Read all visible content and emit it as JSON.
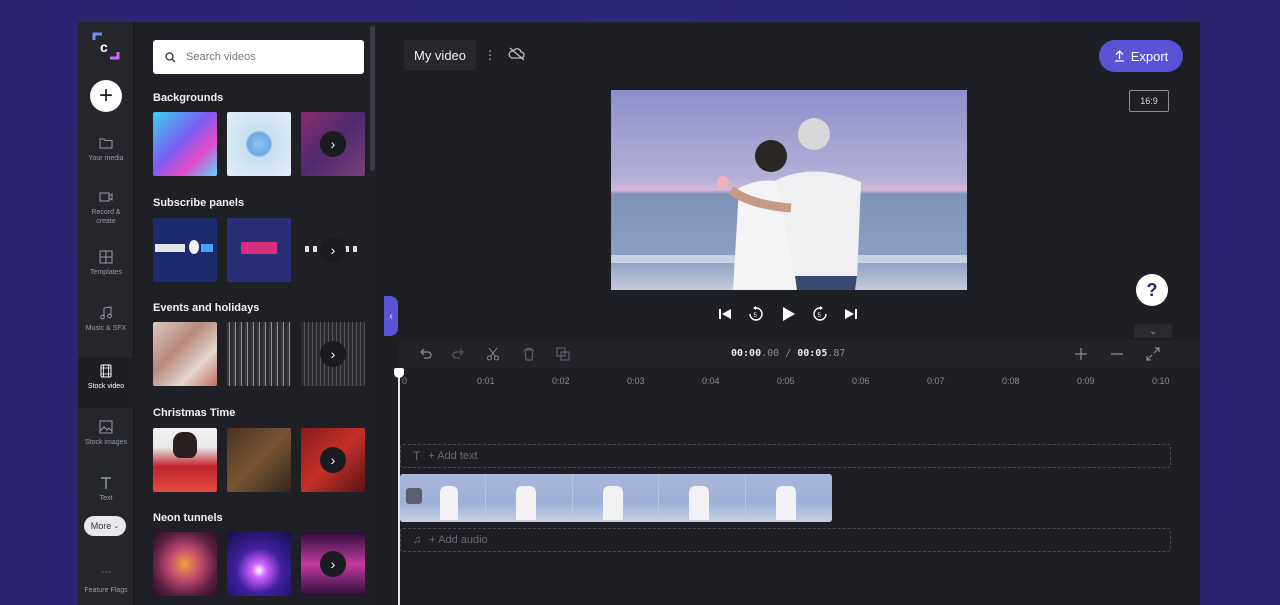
{
  "rail": {
    "more_label": "More",
    "items": [
      {
        "label": "Your media",
        "icon": "folder-icon"
      },
      {
        "label": "Record & create",
        "icon": "camera-icon"
      },
      {
        "label": "Templates",
        "icon": "templates-icon"
      },
      {
        "label": "Music & SFX",
        "icon": "music-icon"
      },
      {
        "label": "Stock video",
        "icon": "film-icon",
        "active": true
      },
      {
        "label": "Stock images",
        "icon": "image-icon"
      },
      {
        "label": "Text",
        "icon": "text-icon"
      },
      {
        "label": "Feature Flags",
        "icon": "dots-icon"
      }
    ]
  },
  "library": {
    "search_placeholder": "Search videos",
    "sections": [
      {
        "title": "Backgrounds"
      },
      {
        "title": "Subscribe panels"
      },
      {
        "title": "Events and holidays"
      },
      {
        "title": "Christmas Time"
      },
      {
        "title": "Neon tunnels"
      }
    ]
  },
  "topbar": {
    "project_name": "My video",
    "export_label": "Export",
    "aspect_ratio": "16:9",
    "help_label": "?"
  },
  "timeline": {
    "time_current_main": "00:00",
    "time_current_frac": ".00",
    "time_sep": " / ",
    "time_total_main": "00:05",
    "time_total_frac": ".87",
    "ruler_ticks": [
      "0",
      "0:01",
      "0:02",
      "0:03",
      "0:04",
      "0:05",
      "0:06",
      "0:07",
      "0:08",
      "0:09",
      "0:10"
    ],
    "add_text_label": "+ Add text",
    "add_audio_label": "+ Add audio"
  },
  "colors": {
    "accent": "#5b53d6",
    "background": "#2a2370",
    "panel": "#1e1f24"
  }
}
